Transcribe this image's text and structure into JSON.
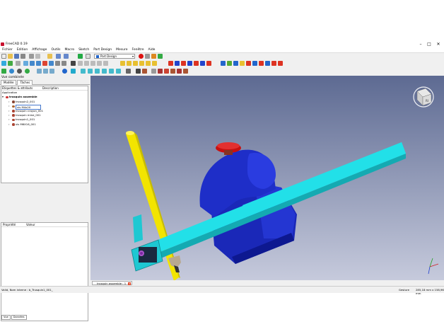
{
  "window": {
    "title": "FreeCAD 0.19",
    "controls": [
      "–",
      "□",
      "✕"
    ]
  },
  "menu": [
    "Fichier",
    "Edition",
    "Affichage",
    "Outils",
    "Macro",
    "Sketch",
    "Part Design",
    "Mesure",
    "Fenêtre",
    "Aide"
  ],
  "workbench": {
    "selected": "Part Design"
  },
  "combo_view": {
    "title": "Vue combinée",
    "tabs": [
      "Modèle",
      "Tâches"
    ],
    "tree_columns": [
      "Étiquettes & attributs",
      "Description"
    ],
    "tree_section": "Application",
    "tree_items": [
      {
        "label": "trusquin assemble",
        "depth": 0,
        "icon_color": "#cc3333",
        "bold": true
      },
      {
        "label": "trusquin2_001",
        "depth": 1,
        "icon_color": "#884433"
      },
      {
        "label": "vis M4x20",
        "depth": 1,
        "icon_color": "#aa6633",
        "editing": true
      },
      {
        "label": "trusquin crayon_001",
        "depth": 1,
        "icon_color": "#aa4433"
      },
      {
        "label": "trusquin mine_001",
        "depth": 1,
        "icon_color": "#aa4433"
      },
      {
        "label": "trusquin1_001",
        "depth": 1,
        "icon_color": "#aa4433"
      },
      {
        "label": "vis M6X16_001",
        "depth": 1,
        "icon_color": "#aa4433"
      }
    ],
    "property_columns": [
      "Propriété",
      "Valeur"
    ],
    "bottom_tabs": [
      "Vue",
      "Données"
    ]
  },
  "document_tab": {
    "label": "trusquin assemble : 1"
  },
  "status_bar": {
    "message": "Valid, Nom interne : b_Trusquin1_001_",
    "navigation": "Gesture",
    "dimensions": "285,18 mm x 158,96 mm"
  },
  "colors": {
    "blue_body": "#1f2fcf",
    "cyan_bar": "#22e0e8",
    "yellow_pencil": "#f0e000",
    "red_knob": "#cc1010",
    "viewport_top": "#5d6a92",
    "viewport_bottom": "#c6cadc"
  },
  "icons": [
    "new-icon",
    "open-icon",
    "save-icon",
    "print-icon",
    "cut-icon",
    "copy-icon",
    "paste-icon",
    "undo-icon",
    "redo-icon",
    "refresh-icon",
    "pointer-icon",
    "macro-record-icon",
    "macro-run-icon",
    "view-fit-icon",
    "view-iso-icon",
    "view-front-icon",
    "view-top-icon",
    "view-right-icon",
    "view-rear-icon",
    "view-bottom-icon",
    "view-left-icon",
    "measure-icon",
    "navigation-cube-icon"
  ]
}
